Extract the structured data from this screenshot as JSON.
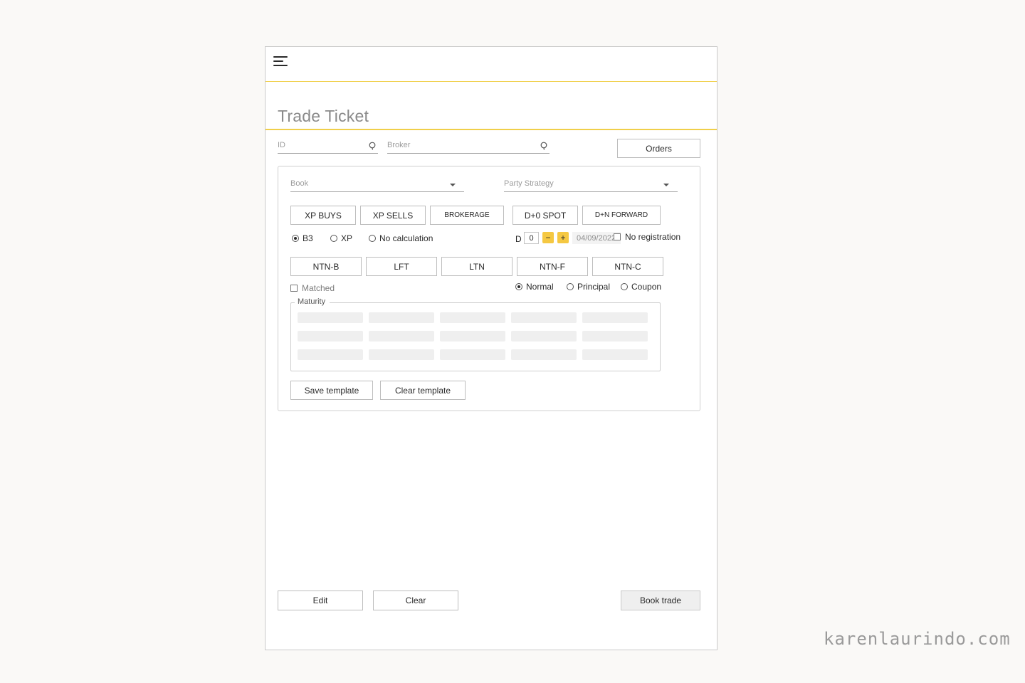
{
  "page": {
    "title": "Trade Ticket"
  },
  "header": {
    "menu_icon": "hamburger-menu-icon"
  },
  "search": {
    "id_label": "ID",
    "broker_label": "Broker",
    "orders_button": "Orders"
  },
  "book_panel": {
    "book_label": "Book",
    "party_strategy_label": "Party Strategy",
    "side_buttons": [
      "XP BUYS",
      "XP SELLS",
      "BROKERAGE"
    ],
    "settlement_buttons": [
      "D+0 SPOT",
      "D+N FORWARD"
    ],
    "calculation": {
      "options": [
        "B3",
        "XP",
        "No calculation"
      ],
      "selected": "B3"
    },
    "settlement": {
      "d_label": "D",
      "d_value": "0",
      "minus": "−",
      "plus": "+",
      "date": "04/09/2022",
      "no_registration_label": "No registration"
    },
    "instrument_buttons": [
      "NTN-B",
      "LFT",
      "LTN",
      "NTN-F",
      "NTN-C"
    ],
    "matched_label": "Matched",
    "flow": {
      "options": [
        "Normal",
        "Principal",
        "Coupon"
      ],
      "selected": "Normal"
    },
    "maturity_label": "Maturity",
    "save_template": "Save template",
    "clear_template": "Clear template"
  },
  "footer": {
    "edit": "Edit",
    "clear": "Clear",
    "book_trade": "Book trade"
  },
  "watermark": "karenlaurindo.com",
  "colors": {
    "accent": "#f0cf4a",
    "stepper": "#f5c842"
  }
}
